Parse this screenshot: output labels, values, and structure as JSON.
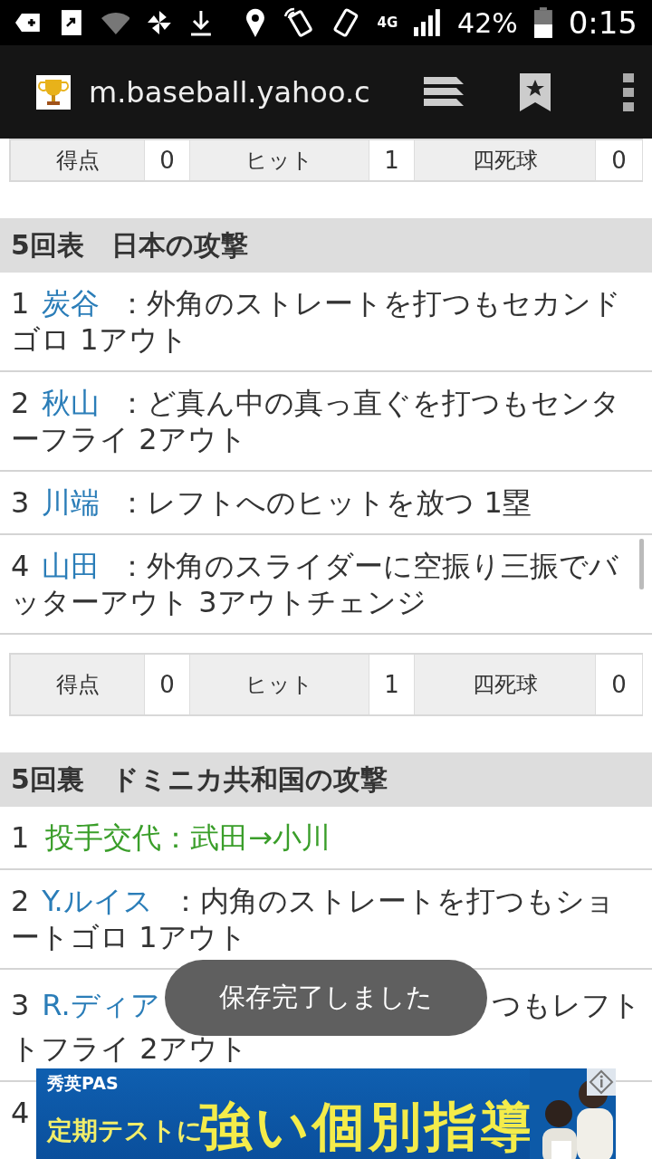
{
  "status_bar": {
    "network": "4G",
    "battery": "42%",
    "time": "0:15"
  },
  "browser": {
    "url": "m.baseball.yahoo.c"
  },
  "blocks": [
    {
      "kind": "stats",
      "stats": [
        {
          "label": "得点",
          "value": "0"
        },
        {
          "label": "ヒット",
          "value": "1"
        },
        {
          "label": "四死球",
          "value": "0"
        }
      ]
    },
    {
      "kind": "header",
      "title": "5回表　日本の攻撃"
    },
    {
      "kind": "play",
      "number": "1",
      "player": "炭谷",
      "text": "：外角のストレートを打つもセカンドゴロ 1アウト"
    },
    {
      "kind": "play",
      "number": "2",
      "player": "秋山",
      "text": "：ど真ん中の真っ直ぐを打つもセンターフライ 2アウト"
    },
    {
      "kind": "play",
      "number": "3",
      "player": "川端",
      "text": "：レフトへのヒットを放つ 1塁"
    },
    {
      "kind": "play",
      "number": "4",
      "player": "山田",
      "text": "：外角のスライダーに空振り三振でバッターアウト 3アウトチェンジ"
    },
    {
      "kind": "stats",
      "stats": [
        {
          "label": "得点",
          "value": "0"
        },
        {
          "label": "ヒット",
          "value": "1"
        },
        {
          "label": "四死球",
          "value": "0"
        }
      ]
    },
    {
      "kind": "header",
      "title": "5回裏　ドミニカ共和国の攻撃"
    },
    {
      "kind": "change",
      "number": "1",
      "text": "投手交代：武田→小川"
    },
    {
      "kind": "play",
      "number": "2",
      "player": "Y.ルイス",
      "text": "：内角のストレートを打つもショートゴロ 1アウト"
    },
    {
      "kind": "covered",
      "number": "3",
      "player": "R.ディア",
      "line1": "つもレフト",
      "line2": "トフライ 2アウト"
    },
    {
      "kind": "number",
      "number": "4"
    }
  ],
  "toast": "保存完了しました",
  "ad": {
    "brand": "秀英PAS",
    "lead": "定期テストに",
    "headline": "強い個別指導"
  }
}
